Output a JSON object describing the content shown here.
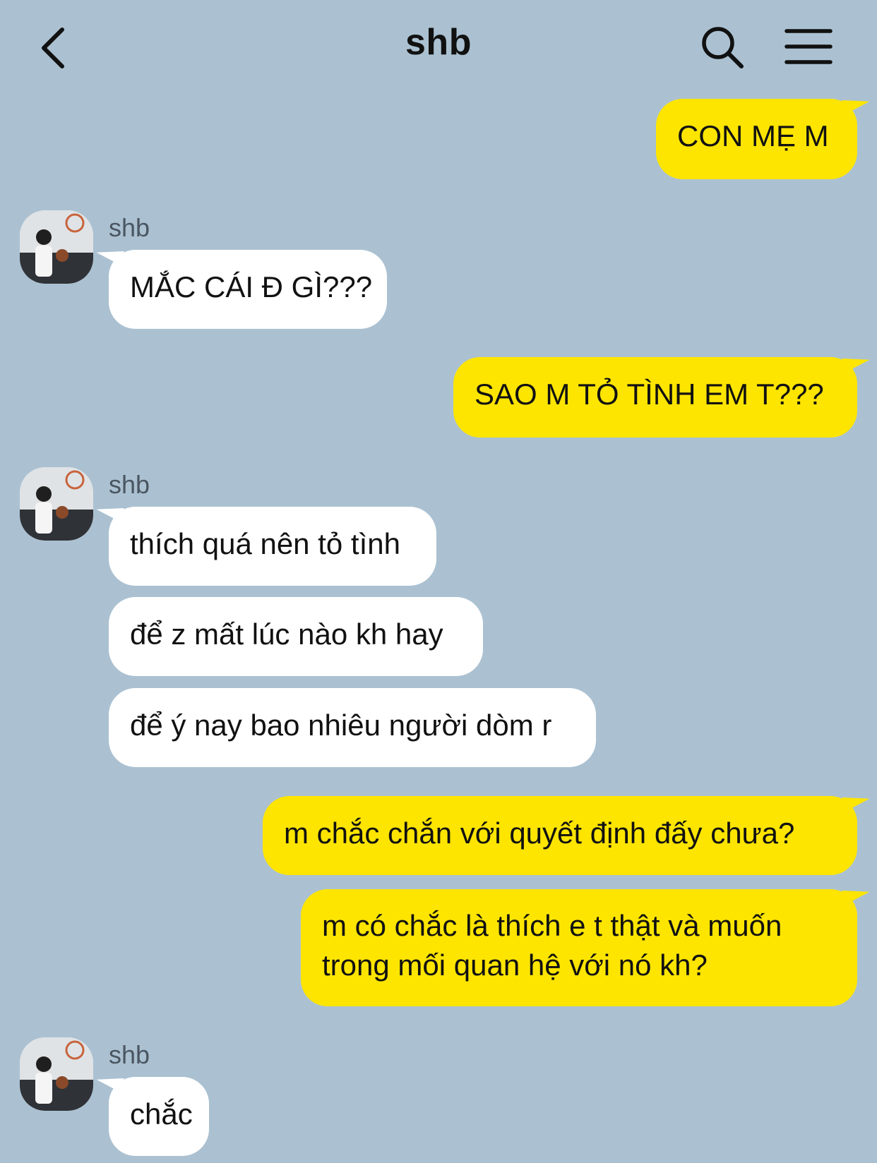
{
  "header": {
    "title": "shb"
  },
  "messages": [
    {
      "from": "me",
      "text": "CON MẸ M"
    },
    {
      "from": "them",
      "sender": "shb",
      "text": "MẮC CÁI Đ GÌ???"
    },
    {
      "from": "me",
      "text": "SAO M TỎ TÌNH EM T???"
    },
    {
      "from": "them",
      "sender": "shb",
      "text": "thích quá nên tỏ tình"
    },
    {
      "from": "them",
      "text": "để z mất lúc nào kh hay"
    },
    {
      "from": "them",
      "text": "để ý nay bao nhiêu người dòm r"
    },
    {
      "from": "me",
      "text": "m chắc chắn với quyết định đấy chưa?"
    },
    {
      "from": "me",
      "text": "m có chắc là thích e t thật và muốn trong mối quan hệ với nó kh?"
    },
    {
      "from": "them",
      "sender": "shb",
      "text": "chắc"
    }
  ],
  "colors": {
    "background": "#abc1d1",
    "my_bubble": "#fee500",
    "their_bubble": "#ffffff"
  },
  "icons": [
    "back-icon",
    "search-icon",
    "menu-icon"
  ]
}
